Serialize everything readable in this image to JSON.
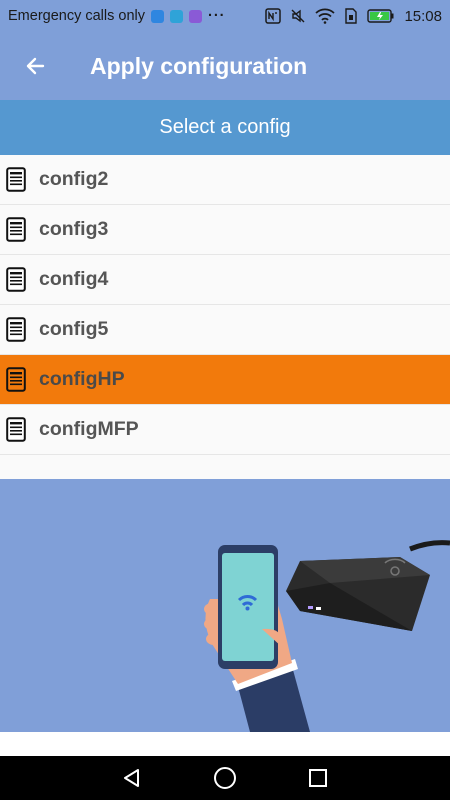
{
  "status_bar": {
    "carrier_text": "Emergency calls only",
    "time": "15:08",
    "icons": [
      "shield-app-icon",
      "gallery-app-icon",
      "photo-app-icon",
      "more-dots-icon",
      "nfc-icon",
      "mute-icon",
      "wifi-icon",
      "sim-icon",
      "battery-charging-icon"
    ],
    "colors": {
      "shield_app": "#2f86e0",
      "gallery_app": "#2fa3d8",
      "photo_app": "#8a5ad6",
      "battery": "#38c744"
    }
  },
  "app_bar": {
    "back_icon": "arrow-left-icon",
    "title": "Apply configuration"
  },
  "section_header": {
    "title": "Select a config"
  },
  "configs": [
    {
      "label": "config2",
      "selected": false,
      "icon": "document-icon"
    },
    {
      "label": "config3",
      "selected": false,
      "icon": "document-icon"
    },
    {
      "label": "config4",
      "selected": false,
      "icon": "document-icon"
    },
    {
      "label": "config5",
      "selected": false,
      "icon": "document-icon"
    },
    {
      "label": "configHP",
      "selected": true,
      "icon": "document-icon"
    },
    {
      "label": "configMFP",
      "selected": false,
      "icon": "document-icon"
    }
  ],
  "illustration": {
    "description_icon": "phone-tap-reader-illustration"
  },
  "nav_bar": {
    "buttons": [
      "back-triangle-icon",
      "home-circle-icon",
      "recents-square-icon"
    ]
  },
  "colors": {
    "primary": "#7f9fd8",
    "header": "#5598d0",
    "selected": "#f27a0c",
    "list_bg": "#fafafa"
  }
}
